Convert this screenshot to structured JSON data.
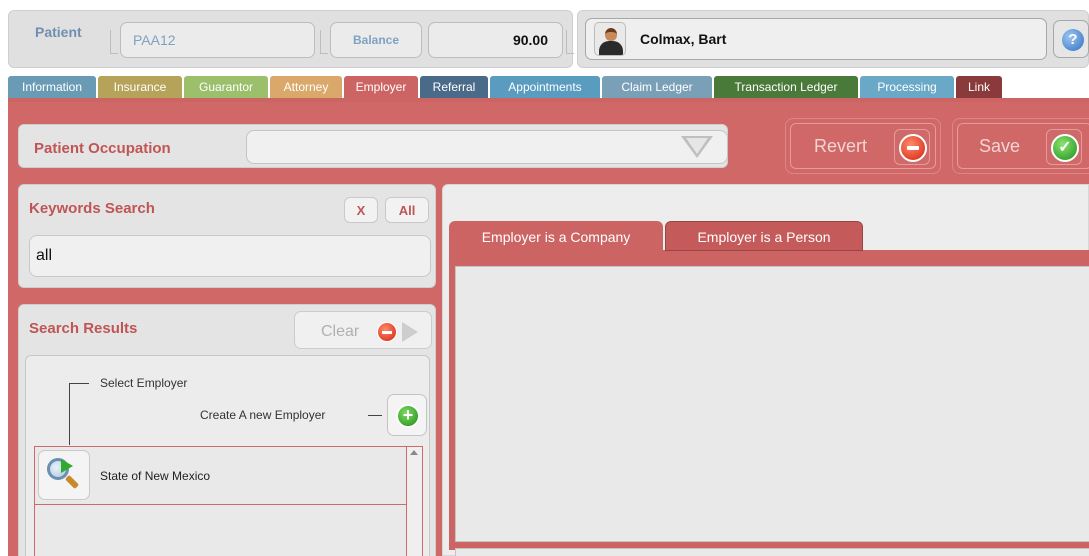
{
  "header": {
    "patient_label": "Patient",
    "patient_id": "PAA12",
    "balance_label": "Balance",
    "balance_value": "90.00",
    "patient_name": "Colmax, Bart",
    "help_glyph": "?"
  },
  "tabs": [
    {
      "label": "Information",
      "color": "#6a9bb5"
    },
    {
      "label": "Insurance",
      "color": "#b5a35a"
    },
    {
      "label": "Guarantor",
      "color": "#9bbf6a"
    },
    {
      "label": "Attorney",
      "color": "#d9a86a"
    },
    {
      "label": "Employer",
      "color": "#cd6464"
    },
    {
      "label": "Referral",
      "color": "#4a6a8a"
    },
    {
      "label": "Appointments",
      "color": "#5a9bc0"
    },
    {
      "label": "Claim Ledger",
      "color": "#7aa0b8"
    },
    {
      "label": "Transaction Ledger",
      "color": "#4a7a3a"
    },
    {
      "label": "Processing",
      "color": "#6aa8c8"
    },
    {
      "label": "Link",
      "color": "#8a3a3a"
    }
  ],
  "active_tab": "Employer",
  "occupation": {
    "label": "Patient Occupation",
    "value": ""
  },
  "actions": {
    "revert_label": "Revert",
    "save_label": "Save"
  },
  "keywords": {
    "label": "Keywords Search",
    "x_label": "X",
    "all_label": "All",
    "value": "all"
  },
  "search_results": {
    "label": "Search Results",
    "clear_label": "Clear",
    "select_employer": "Select Employer",
    "create_new": "Create A new Employer",
    "plus_glyph": "+",
    "items": [
      {
        "name": "State of New Mexico"
      }
    ]
  },
  "employer_tabs": [
    {
      "label": "Employer is a Company",
      "active": true
    },
    {
      "label": "Employer is a Person",
      "active": false
    }
  ],
  "colors": {
    "accent": "#cd6464",
    "panel": "#e4e4e4",
    "label_red": "#c05555",
    "id_blue": "#7fa2c2"
  }
}
